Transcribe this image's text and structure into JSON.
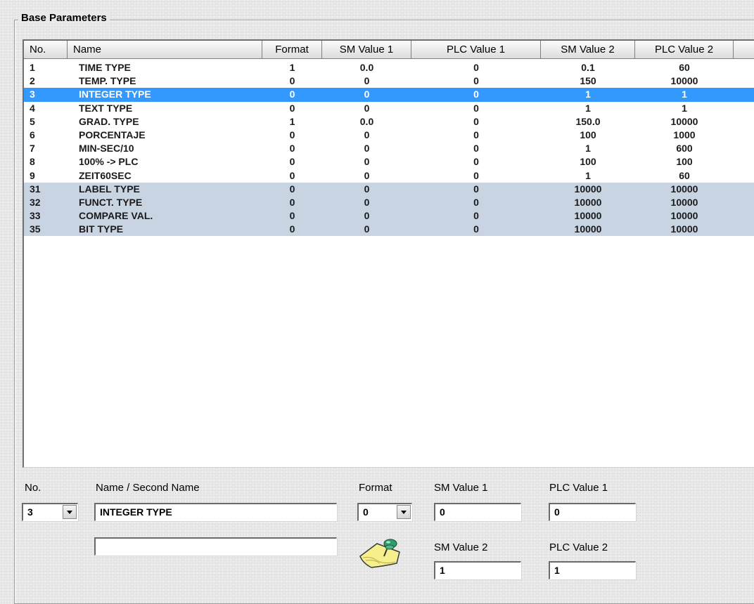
{
  "group_title": "Base Parameters",
  "columns": {
    "no": "No.",
    "name": "Name",
    "format": "Format",
    "sm1": "SM Value 1",
    "plc1": "PLC Value 1",
    "sm2": "SM Value 2",
    "plc2": "PLC Value 2"
  },
  "rows": [
    {
      "no": "1",
      "name": "TIME TYPE",
      "format": "1",
      "sm1": "0.0",
      "plc1": "0",
      "sm2": "0.1",
      "plc2": "60",
      "style": "normal"
    },
    {
      "no": "2",
      "name": "TEMP. TYPE",
      "format": "0",
      "sm1": "0",
      "plc1": "0",
      "sm2": "150",
      "plc2": "10000",
      "style": "normal"
    },
    {
      "no": "3",
      "name": "INTEGER TYPE",
      "format": "0",
      "sm1": "0",
      "plc1": "0",
      "sm2": "1",
      "plc2": "1",
      "style": "selected"
    },
    {
      "no": "4",
      "name": "TEXT TYPE",
      "format": "0",
      "sm1": "0",
      "plc1": "0",
      "sm2": "1",
      "plc2": "1",
      "style": "normal"
    },
    {
      "no": "5",
      "name": "GRAD. TYPE",
      "format": "1",
      "sm1": "0.0",
      "plc1": "0",
      "sm2": "150.0",
      "plc2": "10000",
      "style": "normal"
    },
    {
      "no": "6",
      "name": "PORCENTAJE",
      "format": "0",
      "sm1": "0",
      "plc1": "0",
      "sm2": "100",
      "plc2": "1000",
      "style": "normal"
    },
    {
      "no": "7",
      "name": "MIN-SEC/10",
      "format": "0",
      "sm1": "0",
      "plc1": "0",
      "sm2": "1",
      "plc2": "600",
      "style": "normal"
    },
    {
      "no": "8",
      "name": "100% -> PLC",
      "format": "0",
      "sm1": "0",
      "plc1": "0",
      "sm2": "100",
      "plc2": "100",
      "style": "normal"
    },
    {
      "no": "9",
      "name": "ZEIT60SEC",
      "format": "0",
      "sm1": "0",
      "plc1": "0",
      "sm2": "1",
      "plc2": "60",
      "style": "normal"
    },
    {
      "no": "31",
      "name": "LABEL TYPE",
      "format": "0",
      "sm1": "0",
      "plc1": "0",
      "sm2": "10000",
      "plc2": "10000",
      "style": "shade"
    },
    {
      "no": "32",
      "name": "FUNCT. TYPE",
      "format": "0",
      "sm1": "0",
      "plc1": "0",
      "sm2": "10000",
      "plc2": "10000",
      "style": "shade"
    },
    {
      "no": "33",
      "name": "COMPARE VAL.",
      "format": "0",
      "sm1": "0",
      "plc1": "0",
      "sm2": "10000",
      "plc2": "10000",
      "style": "shade"
    },
    {
      "no": "35",
      "name": "BIT TYPE",
      "format": "0",
      "sm1": "0",
      "plc1": "0",
      "sm2": "10000",
      "plc2": "10000",
      "style": "shade"
    }
  ],
  "editor": {
    "no_label": "No.",
    "name_label": "Name / Second Name",
    "format_label": "Format",
    "sm1_label": "SM Value 1",
    "plc1_label": "PLC Value 1",
    "sm2_label": "SM Value 2",
    "plc2_label": "PLC Value 2",
    "no_value": "3",
    "name_value": "INTEGER TYPE",
    "second_name_value": "",
    "format_value": "0",
    "sm1_value": "0",
    "plc1_value": "0",
    "sm2_value": "1",
    "plc2_value": "1",
    "pin_icon": "pushpin-note-icon"
  },
  "colors": {
    "selected_row": "#3399ff",
    "shaded_row": "#c9d4e3"
  }
}
